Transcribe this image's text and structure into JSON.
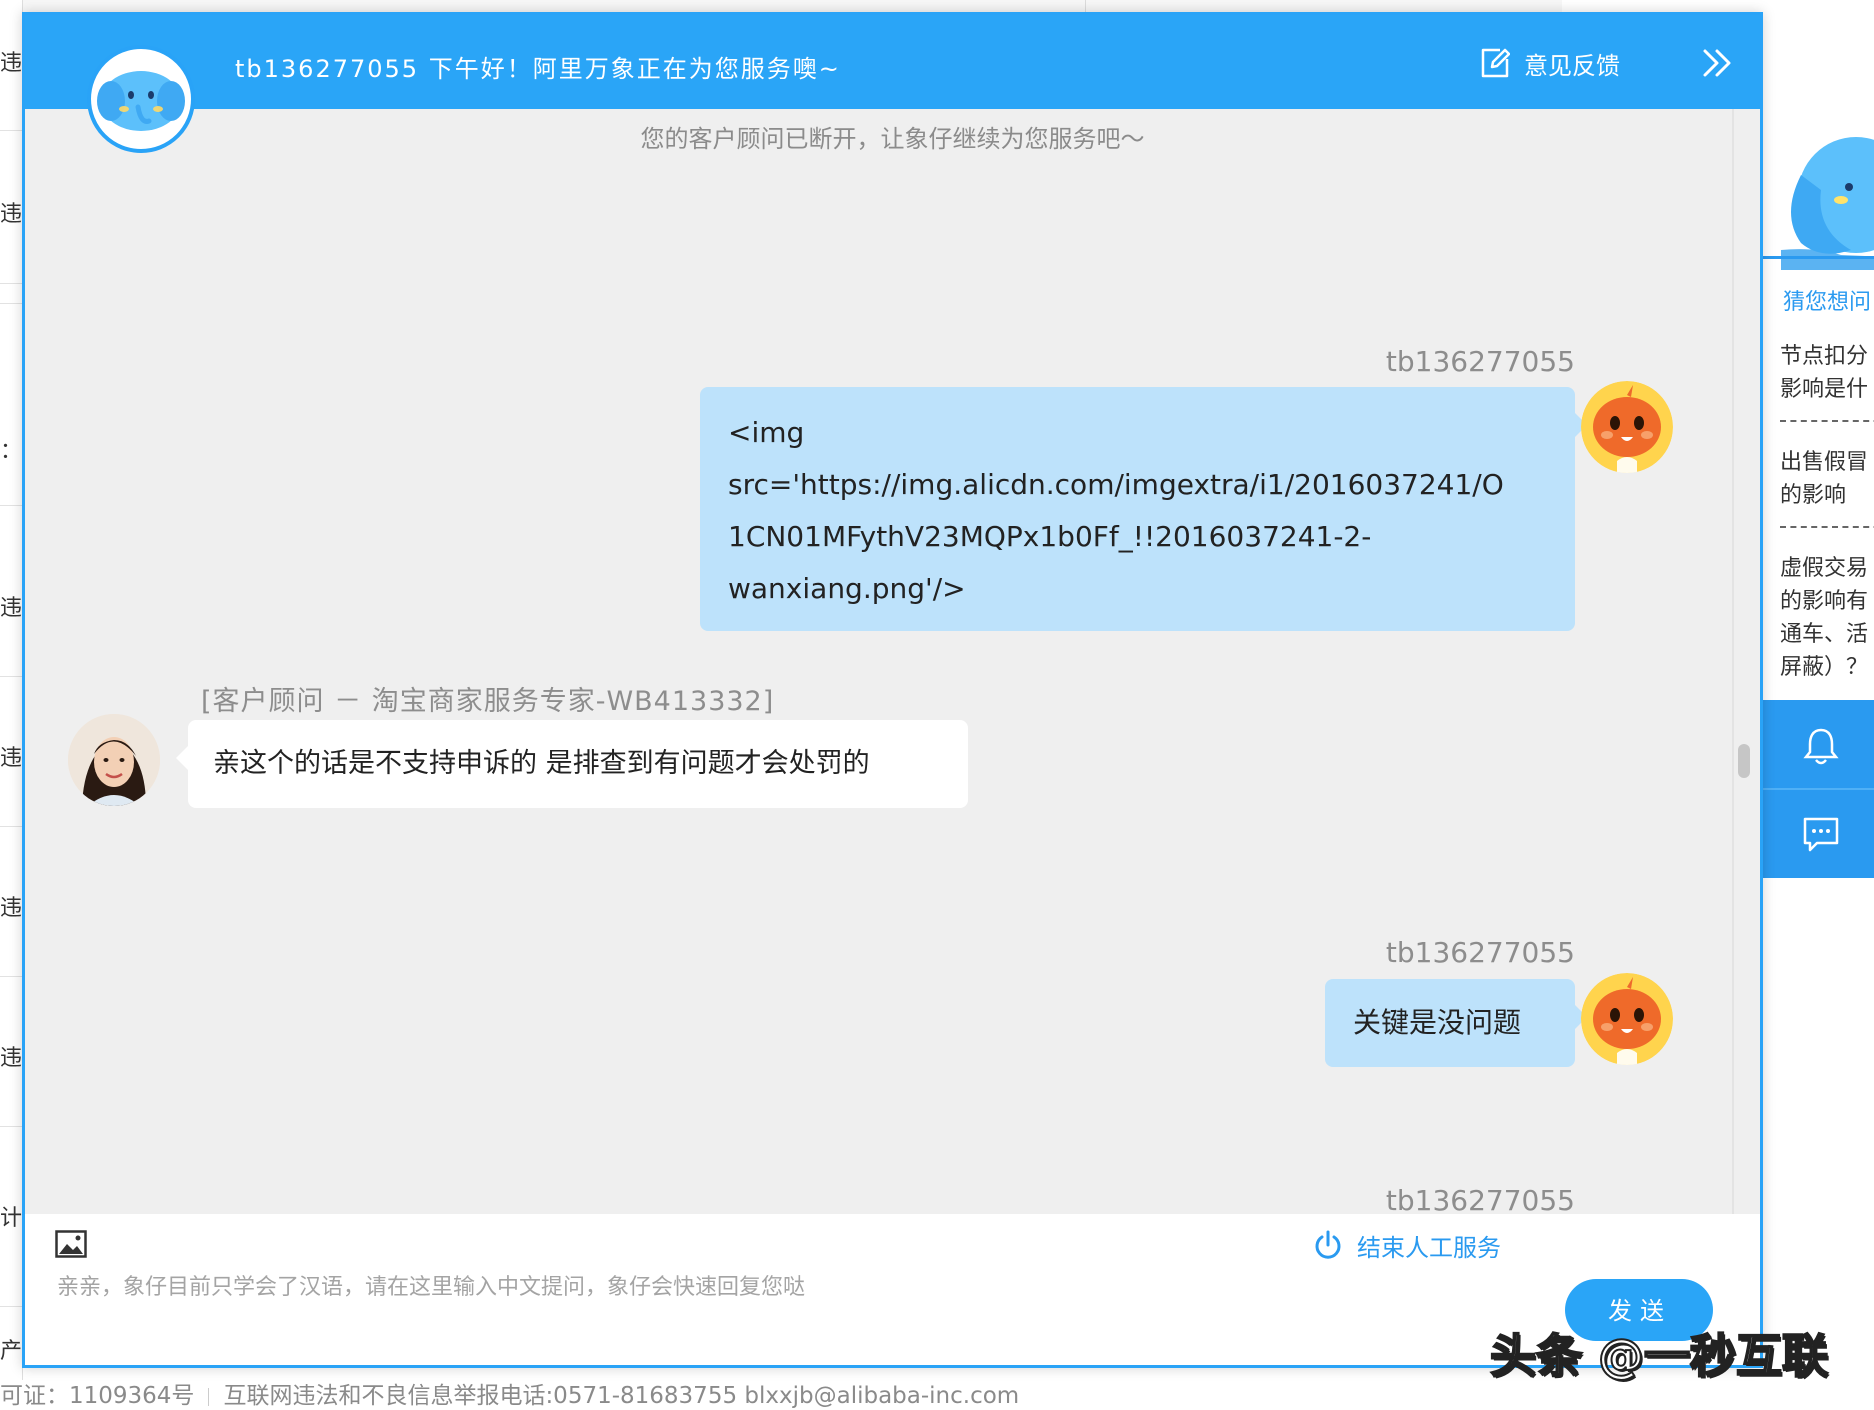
{
  "header": {
    "greeting": "tb136277055  下午好！阿里万象正在为您服务噢~",
    "feedback_label": "意见反馈"
  },
  "chat": {
    "notice": "您的客户顾问已断开，让象仔继续为您服务吧～",
    "messages": [
      {
        "sender": "tb136277055",
        "lines": [
          "<img",
          "src='https://img.alicdn.com/imgextra/i1/2016037241/O",
          "1CN01MFythV23MQPx1b0Ff_!!2016037241-2-",
          "wanxiang.png'/>"
        ]
      },
      {
        "sender": "[客户顾问 － 淘宝商家服务专家-WB413332]",
        "text": "亲这个的话是不支持申诉的 是排查到有问题才会处罚的"
      },
      {
        "sender": "tb136277055",
        "text": "关键是没问题"
      },
      {
        "sender": "tb136277055"
      }
    ]
  },
  "input": {
    "placeholder": "亲亲，象仔目前只学会了汉语，请在这里输入中文提问，象仔会快速回复您哒",
    "end_service_label": "结束人工服务",
    "send_label": "发送"
  },
  "right_panel": {
    "title": "猜您想问",
    "questions": [
      [
        "节点扣分",
        "影响是什"
      ],
      [
        "出售假冒",
        "的影响"
      ],
      [
        "虚假交易",
        "的影响有",
        "通车、活",
        "屏蔽）？"
      ]
    ]
  },
  "footer": {
    "license": "可证：1109364号",
    "report": "互联网违法和不良信息举报电话:0571-81683755 blxxjb@alibaba-inc.com"
  },
  "background": {
    "left_texts": [
      "违规",
      "违规",
      "：",
      "违规",
      "违规",
      "违规",
      "违规",
      "计算",
      "产"
    ]
  },
  "watermark": "头条 @一秒互联",
  "colors": {
    "primary": "#2aa5f7",
    "user_bubble": "#bde2fb",
    "agent_bubble": "#ffffff",
    "chat_bg": "#efefef"
  }
}
